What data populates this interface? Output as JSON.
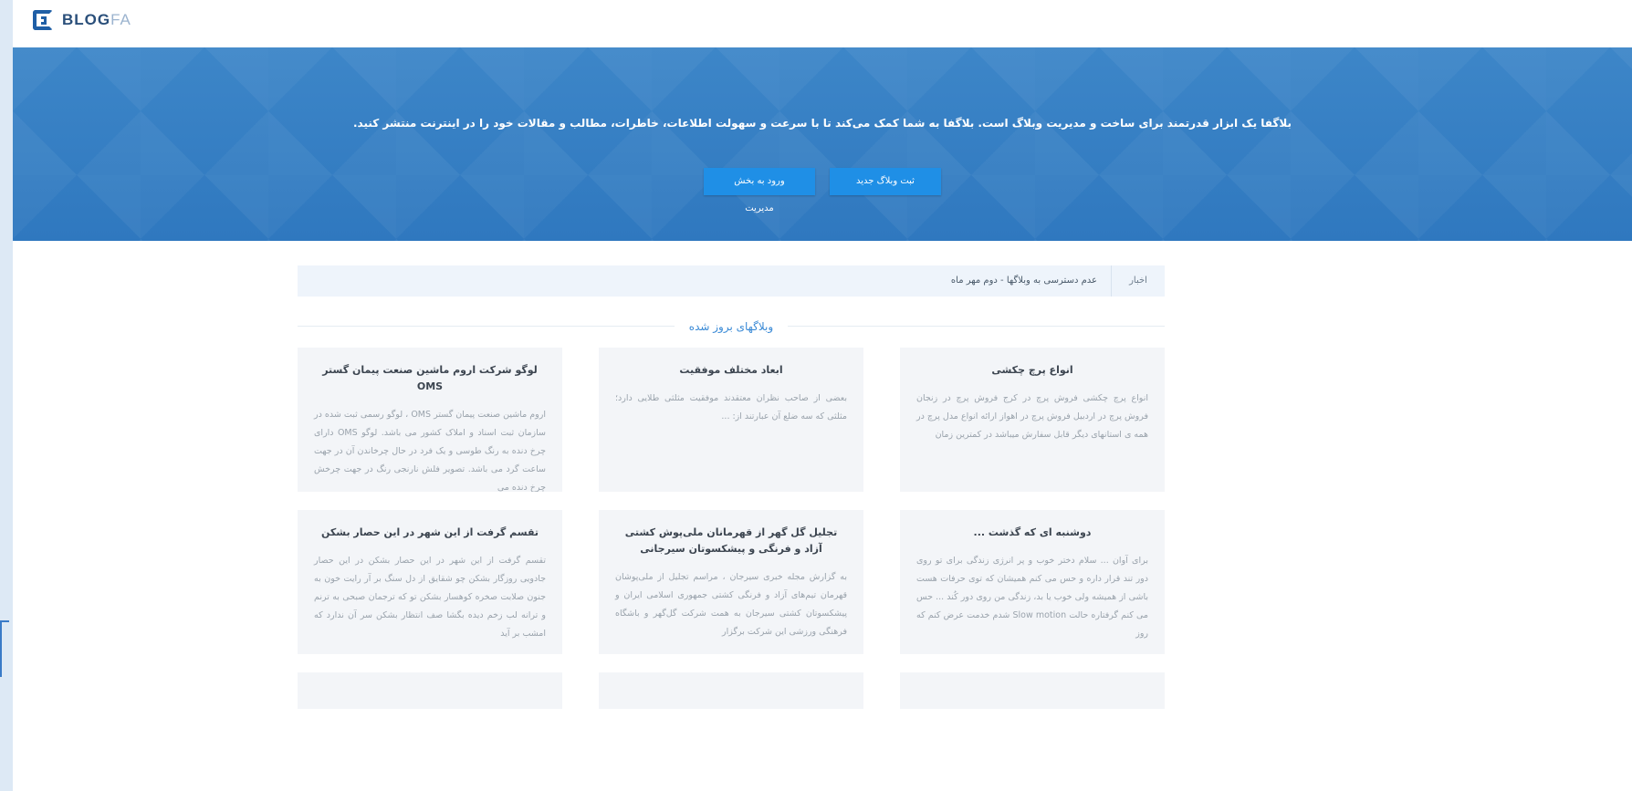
{
  "brand": {
    "name_main": "BLOG",
    "name_accent": "FA"
  },
  "hero": {
    "description": "بلاگفا یک ابزار قدرتمند برای ساخت و مدیریت وبلاگ است. بلاگفا به شما کمک می‌کند تا با سرعت و سهولت اطلاعات، خاطرات، مطالب و مقالات خود را در اینترنت منتشر کنید.",
    "register_label": "ثبت وبلاگ جدید",
    "login_label": "ورود به بخش مدیریت"
  },
  "news": {
    "label": "اخبار",
    "text": "عدم دسترسی به وبلاگها - دوم مهر ماه"
  },
  "section": {
    "title": "وبلاگهای بروز شده"
  },
  "cards": [
    {
      "title": "انواع پرچ چکشی",
      "body": "انواع پرچ چکشی فروش پرچ در کرج فروش پرچ در زنجان فروش پرچ در اردبیل فروش پرچ در اهواز ارائه انواع مدل پرچ در همه ی استانهای دیگر قابل سفارش میباشد در کمترین زمان"
    },
    {
      "title": "ابعاد مختلف موفقیت",
      "body": "بعضی از صاحب نظران معتقدند موفقیت مثلثی طلایی دارد؛ مثلثی که سه ضلع آن عبارتند از: ..."
    },
    {
      "title": "لوگو شرکت اروم ماشین صنعت پیمان گستر OMS",
      "body": "اروم ماشین صنعت پیمان گستر OMS ، لوگو رسمی ثبت شده در سازمان ثبت اسناد و املاک کشور می باشد. لوگو OMS دارای چرخ دنده به رنگ طوسی و یک فرد در حال چرخاندن آن در جهت ساعت گرد می باشد. تصویر فلش نارنجی رنگ در جهت چرخش چرخ دنده می"
    },
    {
      "title": "دوشنبه ای که گذشت ...",
      "body": "برای آوان ... سلام دختر خوب و پر انرژی زندگی برای تو روی دور تند قرار داره و حس می کنم همیشان که توی حرفات هست باشی از همیشه ولی خوب یا بد، زندگی من روی دور کُند ... حس می کنم گرفتاره حالت Slow motion شدم خدمت عرض کنم که روز"
    },
    {
      "title": "تجلیل گل گهر از قهرمانان ملی‌پوش کشتی آزاد و فرنگی و پیشکسوتان سیرجانی",
      "body": "به گزارش مجله خبری سیرجان ، مراسم تجلیل از ملی‌پوشان قهرمان تیم‌های آزاد و فرنگی کشتی جمهوری اسلامی ایران و پیشکسوتان کشتی سیرجان به همت شرکت گل‌گهر و باشگاه فرهنگی ورزشی این شرکت برگزار"
    },
    {
      "title": "تقسم گرفت از این شهر در این حصار بشکن",
      "body": "تقسم گرفت از این شهر در این حصار بشکن در این حصار جادویی روزگار بشکن چو شقایق از دل سنگ بر آر رایت خون به جنون صلابت صخره کوهسار بشکن تو که ترجمان صبحی به ترنم و ترانه لب زخم دیده بگشا صف انتظار بشکن سر آن ندارد که امشب بر آید"
    }
  ]
}
